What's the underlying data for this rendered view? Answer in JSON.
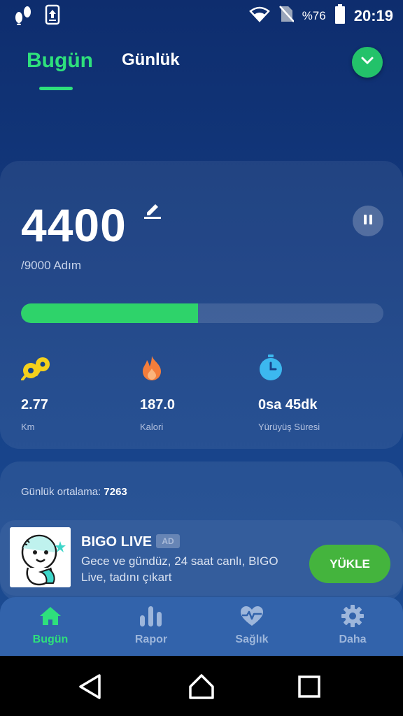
{
  "status_bar": {
    "battery_pct": "%76",
    "time": "20:19",
    "icons": [
      "footsteps-icon",
      "upload-icon",
      "wifi-icon",
      "no-sim-icon",
      "battery-icon"
    ]
  },
  "header": {
    "tabs": [
      {
        "label": "Bugün",
        "active": true
      },
      {
        "label": "Günlük",
        "active": false
      }
    ]
  },
  "today": {
    "steps": "4400",
    "goal_text": "/9000 Adım",
    "progress": 0.489,
    "stats": [
      {
        "value": "2.77",
        "label": "Km",
        "icon": "footprints-icon"
      },
      {
        "value": "187.0",
        "label": "Kalori",
        "icon": "flame-icon"
      },
      {
        "value": "0sa 45dk",
        "label": "Yürüyüş Süresi",
        "icon": "stopwatch-icon"
      }
    ]
  },
  "average": {
    "label": "Günlük ortalama:",
    "value": "7263"
  },
  "ad": {
    "title": "BIGO LIVE",
    "badge": "AD",
    "description": "Gece ve gündüz, 24 saat canlı, BIGO Live, tadını çıkart",
    "cta": "YÜKLE"
  },
  "bottom_nav": {
    "items": [
      {
        "label": "Bugün",
        "icon": "home-icon",
        "active": true
      },
      {
        "label": "Rapor",
        "icon": "bar-chart-icon",
        "active": false
      },
      {
        "label": "Sağlık",
        "icon": "heart-pulse-icon",
        "active": false
      },
      {
        "label": "Daha",
        "icon": "gear-icon",
        "active": false
      }
    ]
  },
  "colors": {
    "accent_green": "#2ee07c",
    "progress_green": "#2ed36a",
    "cta_green": "#44b43d",
    "background_top": "#0e2d6e",
    "nav_bg": "#3263ab"
  }
}
